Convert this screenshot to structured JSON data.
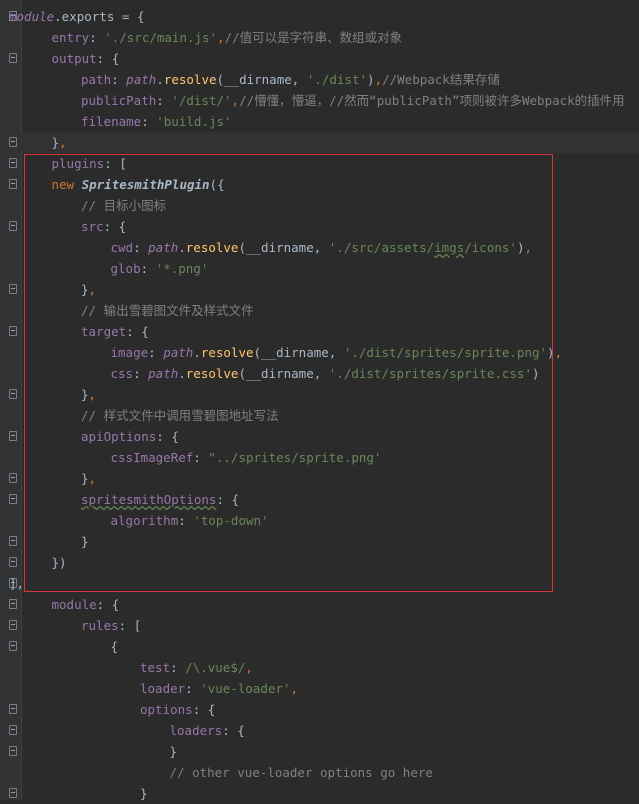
{
  "lines": [
    {
      "indent": 0,
      "fold": "open",
      "tokens": [
        [
          "var",
          "module"
        ],
        [
          "plain",
          ".exports = {"
        ]
      ]
    },
    {
      "indent": 1,
      "fold": "",
      "tokens": [
        [
          "prop",
          "entry"
        ],
        [
          "plain",
          ": "
        ],
        [
          "str",
          "'./src/main.js'"
        ],
        [
          "punct",
          ","
        ],
        [
          "comment",
          "//值可以是字符串、数组或对象"
        ]
      ]
    },
    {
      "indent": 1,
      "fold": "open",
      "tokens": [
        [
          "prop",
          "output"
        ],
        [
          "plain",
          ": {"
        ]
      ]
    },
    {
      "indent": 2,
      "fold": "",
      "tokens": [
        [
          "prop",
          "path"
        ],
        [
          "plain",
          ": "
        ],
        [
          "var",
          "path"
        ],
        [
          "plain",
          "."
        ],
        [
          "fn",
          "resolve"
        ],
        [
          "plain",
          "(__dirname, "
        ],
        [
          "str",
          "'./dist'"
        ],
        [
          "plain",
          ")"
        ],
        [
          "punct",
          ","
        ],
        [
          "comment",
          "//Webpack结果存储"
        ]
      ]
    },
    {
      "indent": 2,
      "fold": "",
      "tokens": [
        [
          "prop",
          "publicPath"
        ],
        [
          "plain",
          ": "
        ],
        [
          "str",
          "'/dist/'"
        ],
        [
          "punct",
          ","
        ],
        [
          "comment",
          "//懵懂，懵逼，//然而“publicPath”项则被许多Webpack的插件用"
        ]
      ]
    },
    {
      "indent": 2,
      "fold": "",
      "tokens": [
        [
          "prop",
          "filename"
        ],
        [
          "plain",
          ": "
        ],
        [
          "str",
          "'build.js'"
        ]
      ]
    },
    {
      "indent": 1,
      "fold": "close",
      "tokens": [
        [
          "plain",
          "}"
        ],
        [
          "punct",
          ","
        ]
      ],
      "current": true
    },
    {
      "indent": 1,
      "fold": "open",
      "tokens": [
        [
          "prop",
          "plugins"
        ],
        [
          "plain",
          ": ["
        ]
      ]
    },
    {
      "indent": 1,
      "fold": "open",
      "tokens": [
        [
          "kw",
          "new "
        ],
        [
          "class",
          "SpritesmithPlugin"
        ],
        [
          "plain",
          "({"
        ]
      ]
    },
    {
      "indent": 2,
      "fold": "",
      "tokens": [
        [
          "comment",
          "// 目标小图标"
        ]
      ]
    },
    {
      "indent": 2,
      "fold": "open",
      "tokens": [
        [
          "prop",
          "src"
        ],
        [
          "plain",
          ": {"
        ]
      ]
    },
    {
      "indent": 3,
      "fold": "",
      "tokens": [
        [
          "prop",
          "cwd"
        ],
        [
          "plain",
          ": "
        ],
        [
          "var",
          "path"
        ],
        [
          "plain",
          "."
        ],
        [
          "fn",
          "resolve"
        ],
        [
          "plain",
          "(__dirname, "
        ],
        [
          "str",
          "'./src/assets/"
        ],
        [
          "strunder",
          "imgs"
        ],
        [
          "str",
          "/icons'"
        ],
        [
          "plain",
          ")"
        ],
        [
          "punct",
          ","
        ]
      ]
    },
    {
      "indent": 3,
      "fold": "",
      "tokens": [
        [
          "prop",
          "glob"
        ],
        [
          "plain",
          ": "
        ],
        [
          "str",
          "'*.png'"
        ]
      ]
    },
    {
      "indent": 2,
      "fold": "close",
      "tokens": [
        [
          "plain",
          "}"
        ],
        [
          "punct",
          ","
        ]
      ]
    },
    {
      "indent": 2,
      "fold": "",
      "tokens": [
        [
          "comment",
          "// 输出雪碧图文件及样式文件"
        ]
      ]
    },
    {
      "indent": 2,
      "fold": "open",
      "tokens": [
        [
          "prop",
          "target"
        ],
        [
          "plain",
          ": {"
        ]
      ]
    },
    {
      "indent": 3,
      "fold": "",
      "tokens": [
        [
          "prop",
          "image"
        ],
        [
          "plain",
          ": "
        ],
        [
          "var",
          "path"
        ],
        [
          "plain",
          "."
        ],
        [
          "fn",
          "resolve"
        ],
        [
          "plain",
          "(__dirname, "
        ],
        [
          "str",
          "'./dist/sprites/sprite.png'"
        ],
        [
          "plain",
          ")"
        ],
        [
          "punct",
          ","
        ]
      ]
    },
    {
      "indent": 3,
      "fold": "",
      "tokens": [
        [
          "prop",
          "css"
        ],
        [
          "plain",
          ": "
        ],
        [
          "var",
          "path"
        ],
        [
          "plain",
          "."
        ],
        [
          "fn",
          "resolve"
        ],
        [
          "plain",
          "(__dirname, "
        ],
        [
          "str",
          "'./dist/sprites/sprite.css'"
        ],
        [
          "plain",
          ")"
        ]
      ]
    },
    {
      "indent": 2,
      "fold": "close",
      "tokens": [
        [
          "plain",
          "}"
        ],
        [
          "punct",
          ","
        ]
      ]
    },
    {
      "indent": 2,
      "fold": "",
      "tokens": [
        [
          "comment",
          "// 样式文件中调用雪碧图地址写法"
        ]
      ]
    },
    {
      "indent": 2,
      "fold": "open",
      "tokens": [
        [
          "prop",
          "apiOptions"
        ],
        [
          "plain",
          ": {"
        ]
      ]
    },
    {
      "indent": 3,
      "fold": "",
      "tokens": [
        [
          "prop",
          "cssImageRef"
        ],
        [
          "plain",
          ": "
        ],
        [
          "str",
          "\"../sprites/sprite.png'"
        ]
      ]
    },
    {
      "indent": 2,
      "fold": "close",
      "tokens": [
        [
          "plain",
          "}"
        ],
        [
          "punct",
          ","
        ]
      ]
    },
    {
      "indent": 2,
      "fold": "open",
      "tokens": [
        [
          "propunder",
          "spritesmithOptions"
        ],
        [
          "plain",
          ": {"
        ]
      ]
    },
    {
      "indent": 3,
      "fold": "",
      "tokens": [
        [
          "prop",
          "algorithm"
        ],
        [
          "plain",
          ": "
        ],
        [
          "str",
          "'top-down'"
        ]
      ]
    },
    {
      "indent": 2,
      "fold": "close",
      "tokens": [
        [
          "plain",
          "}"
        ]
      ]
    },
    {
      "indent": 1,
      "fold": "close",
      "tokens": [
        [
          "plain",
          "})"
        ]
      ]
    },
    {
      "indent": 0,
      "fold": "close",
      "tokens": [
        [
          "plain",
          "],"
        ]
      ]
    },
    {
      "indent": 1,
      "fold": "open",
      "tokens": [
        [
          "prop",
          "module"
        ],
        [
          "plain",
          ": {"
        ]
      ]
    },
    {
      "indent": 2,
      "fold": "open",
      "tokens": [
        [
          "prop",
          "rules"
        ],
        [
          "plain",
          ": ["
        ]
      ]
    },
    {
      "indent": 3,
      "fold": "open",
      "tokens": [
        [
          "plain",
          "{"
        ]
      ]
    },
    {
      "indent": 4,
      "fold": "",
      "tokens": [
        [
          "prop",
          "test"
        ],
        [
          "plain",
          ": "
        ],
        [
          "regex",
          "/\\.vue$/"
        ],
        [
          "punct",
          ","
        ]
      ]
    },
    {
      "indent": 4,
      "fold": "",
      "tokens": [
        [
          "prop",
          "loader"
        ],
        [
          "plain",
          ": "
        ],
        [
          "str",
          "'vue-loader'"
        ],
        [
          "punct",
          ","
        ]
      ]
    },
    {
      "indent": 4,
      "fold": "open",
      "tokens": [
        [
          "prop",
          "options"
        ],
        [
          "plain",
          ": {"
        ]
      ]
    },
    {
      "indent": 5,
      "fold": "open",
      "tokens": [
        [
          "prop",
          "loaders"
        ],
        [
          "plain",
          ": {"
        ]
      ]
    },
    {
      "indent": 5,
      "fold": "close",
      "tokens": [
        [
          "plain",
          "}"
        ]
      ]
    },
    {
      "indent": 5,
      "fold": "",
      "tokens": [
        [
          "comment",
          "// other vue-loader options go here"
        ]
      ]
    },
    {
      "indent": 4,
      "fold": "close",
      "tokens": [
        [
          "plain",
          "}"
        ]
      ]
    }
  ]
}
